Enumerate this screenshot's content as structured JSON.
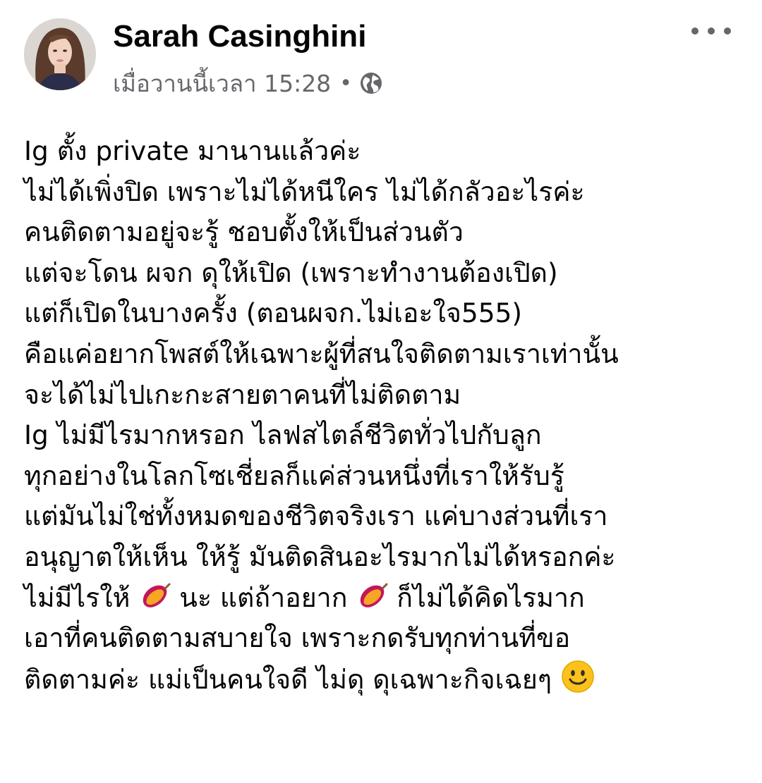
{
  "post": {
    "author": {
      "name": "Sarah Casinghini"
    },
    "timestamp": "เมื่อวานนี้เวลา 15:28",
    "separator": "•",
    "privacy_icon": "globe-icon",
    "more_icon": "more-options-icon",
    "lines": [
      "Ig ตั้ง private มานานแล้วค่ะ",
      "ไม่ได้เพิ่งปิด เพราะไม่ได้หนีใคร ไม่ได้กลัวอะไรค่ะ",
      "คนติดตามอยู่จะรู้ ชอบตั้งให้เป็นส่วนตัว",
      "แต่จะโดน ผจก ดุให้เปิด (เพราะทำงานต้องเปิด)",
      "แต่ก็เปิดในบางครั้ง (ตอนผจก.ไม่เอะใจ555)",
      "คือแค่อยากโพสต์ให้เฉพาะผู้ที่สนใจติดตามเราเท่านั้น",
      "จะได้ไม่ไปเกะกะสายตาคนที่ไม่ติดตาม",
      "Ig ไม่มีไรมากหรอก ไลฟสไตล์ชีวิตทั่วไปกับลูก",
      "ทุกอย่างในโลกโซเชี่ยลก็แค่ส่วนหนึ่งที่เราให้รับรู้",
      "แต่มันไม่ใช่ทั้งหมดของชีวิตจริงเรา แค่บางส่วนที่เรา",
      "อนุญาตให้เห็น ให้รู้ มันติดสินอะไรมากไม่ได้หรอกค่ะ"
    ],
    "emoji_line": {
      "part1": "ไม่มีไรให้",
      "emoji1": "sweet-potato-icon",
      "part2": "นะ แต่ถ้าอยาก",
      "emoji2": "sweet-potato-icon",
      "part3": "ก็ไม่ได้คิดไรมาก"
    },
    "lines_after": [
      "เอาที่คนติดตามสบายใจ เพราะกดรับทุกท่านที่ขอ"
    ],
    "last_line": {
      "text": "ติดตามค่ะ แม่เป็นคนใจดี ไม่ดุ ดุเฉพาะกิจเฉยๆ",
      "emoji": "smiling-face-icon"
    }
  }
}
